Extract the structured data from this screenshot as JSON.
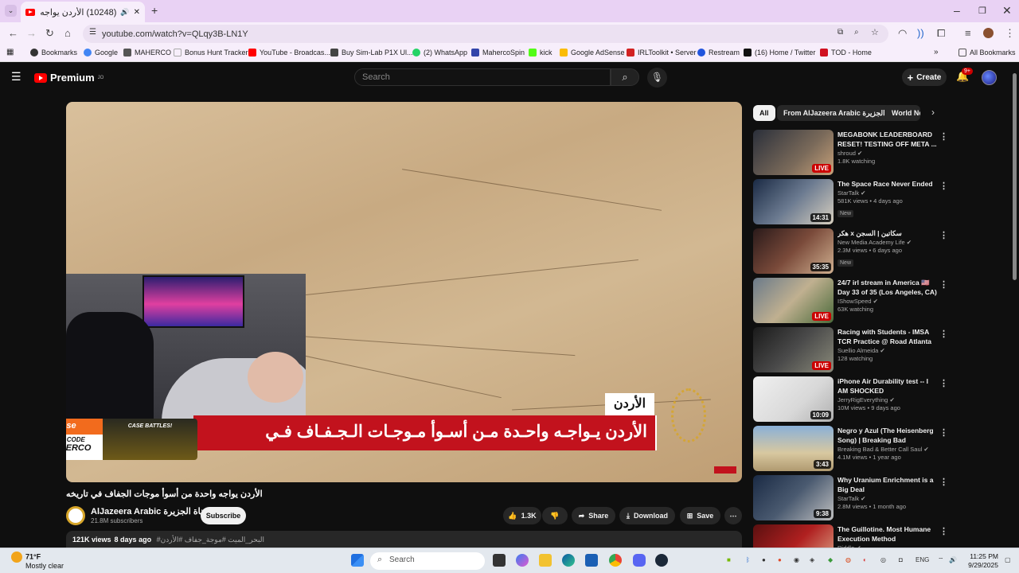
{
  "browser": {
    "tab_title": "(10248) الأردن يواجه واحدة مـ...",
    "url": "youtube.com/watch?v=QLqy3B-LN1Y",
    "bookmarks": [
      {
        "label": "Bookmarks",
        "color": "#333333"
      },
      {
        "label": "Google",
        "color": "#4285f4"
      },
      {
        "label": "MAHERCO",
        "color": "#555555"
      },
      {
        "label": "Bonus Hunt Tracker",
        "color": "#f7eefb"
      },
      {
        "label": "YouTube - Broadcas...",
        "color": "#ff0000"
      },
      {
        "label": "Buy Sim-Lab P1X Ul...",
        "color": "#444444"
      },
      {
        "label": "(2) WhatsApp",
        "color": "#25d366"
      },
      {
        "label": "MahercoSpin",
        "color": "#3344aa"
      },
      {
        "label": "kick",
        "color": "#53fc18"
      },
      {
        "label": "Google AdSense",
        "color": "#fbbc04"
      },
      {
        "label": "IRLToolkit • Server",
        "color": "#d22222"
      },
      {
        "label": "Restream",
        "color": "#2255dd"
      },
      {
        "label": "(16) Home / Twitter",
        "color": "#111111"
      },
      {
        "label": "TOD - Home",
        "color": "#d01020"
      }
    ],
    "all_bookmarks": "All Bookmarks"
  },
  "youtube": {
    "logo": "Premium",
    "logo_sup": "JO",
    "search_placeholder": "Search",
    "create_label": "Create",
    "notif_count": "9+",
    "chips": [
      "All",
      "From AlJazeera Arabic قناة الجزيرة",
      "World News"
    ],
    "video": {
      "lower_third": "الأردن يـواجـه واحـدة مـن أسـوأ مـوجـات الـجـفـاف فـي",
      "location": "الأردن",
      "ad_brand": "Hellcase",
      "ad_code_label": "USE CODE",
      "ad_code": "MAHERCO",
      "ad_tagline": "CASE BATTLES!",
      "title": "الأردن يواجه واحدة من أسوأ موجات الجفاف في تاريخه",
      "channel": "AlJazeera Arabic قناة الجزيرة",
      "subscribers": "21.8M subscribers",
      "subscribe": "Subscribe",
      "likes": "1.3K",
      "share": "Share",
      "download": "Download",
      "save": "Save",
      "views": "121K views",
      "age": "8 days ago",
      "hashtags": "#البحر_الميت #موجة_جفاف #الأردن"
    },
    "recommendations": [
      {
        "title": "MEGABONK LEADERBOARD RESET! TESTING OFF META ...",
        "channel": "shroud",
        "meta": "1.8K watching",
        "badge": "LIVE",
        "live": true,
        "new": false,
        "thumb": "linear-gradient(135deg,#2a2f3a,#7a6a5a 60%,#c9a27a)"
      },
      {
        "title": "The Space Race Never Ended",
        "channel": "StarTalk",
        "meta": "581K views • 4 days ago",
        "badge": "14:31",
        "live": false,
        "new": true,
        "thumb": "linear-gradient(135deg,#1a2a44,#6b7a90 50%,#d8d0c0)"
      },
      {
        "title": "هكر x سكاتين | السجن",
        "channel": "New Media Academy Life",
        "meta": "2.3M views • 6 days ago",
        "badge": "35:35",
        "live": false,
        "new": true,
        "thumb": "linear-gradient(135deg,#2a1a1a,#7a4a3a 50%,#d0b090)"
      },
      {
        "title": "24/7 irl stream in America 🇺🇸 Day 33 of 35 (Los Angeles, CA)",
        "channel": "IShowSpeed",
        "meta": "63K watching",
        "badge": "LIVE",
        "live": true,
        "new": false,
        "thumb": "linear-gradient(135deg,#6a7a8a,#c0b090 50%,#4a6a3a)"
      },
      {
        "title": "Racing with Students - IMSA TCR Practice @ Road Atlanta",
        "channel": "Suellio Almeida",
        "meta": "128 watching",
        "badge": "LIVE",
        "live": true,
        "new": false,
        "thumb": "linear-gradient(135deg,#1a1a1a,#4a4a4a 50%,#8a8a7a)"
      },
      {
        "title": "iPhone Air Durability test -- I AM SHOCKED",
        "channel": "JerryRigEverything",
        "meta": "10M views • 9 days ago",
        "badge": "10:09",
        "live": false,
        "new": false,
        "thumb": "linear-gradient(135deg,#f0f0f0,#d8d8d8 60%,#b0b0b0)"
      },
      {
        "title": "Negro y Azul (The Heisenberg Song) | Breaking Bad",
        "channel": "Breaking Bad & Better Call Saul",
        "meta": "4.1M views • 1 year ago",
        "badge": "3:43",
        "live": false,
        "new": false,
        "thumb": "linear-gradient(180deg,#8ab0d8,#d8c8a0 60%,#b09a70)"
      },
      {
        "title": "Why Uranium Enrichment is a Big Deal",
        "channel": "StarTalk",
        "meta": "2.8M views • 1 month ago",
        "badge": "9:38",
        "live": false,
        "new": false,
        "thumb": "linear-gradient(135deg,#1a2a44,#4a5a70 50%,#c0c0c0)"
      },
      {
        "title": "The Guillotine. Most Humane Execution Method",
        "channel": "Riddle",
        "meta": "",
        "badge": "",
        "live": false,
        "new": false,
        "thumb": "linear-gradient(135deg,#5a1010,#b02020 50%,#e0b090)"
      }
    ],
    "new_label": "New"
  },
  "taskbar": {
    "temp": "71°F",
    "weather": "Mostly clear",
    "search": "Search",
    "lang": "ENG",
    "time": "11:25 PM",
    "date": "9/29/2025"
  }
}
